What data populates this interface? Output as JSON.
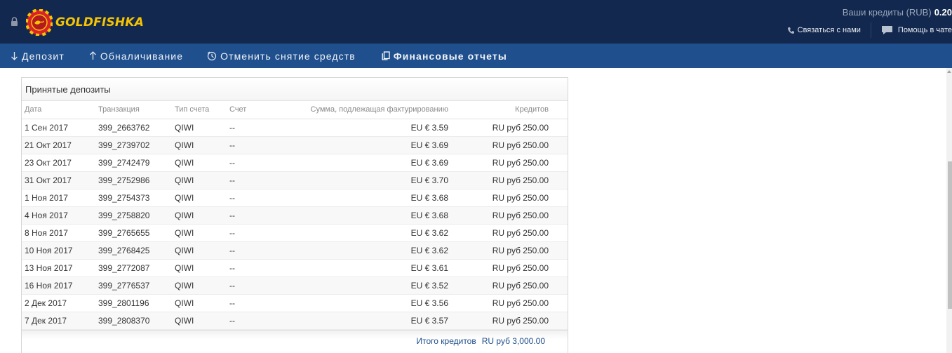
{
  "header": {
    "brand": "GOLDFISHKA",
    "credits_label": "Ваши кредиты (RUB)",
    "credits_value": "0.20",
    "contact_label": "Связаться с нами",
    "chat_label": "Помощь в чате"
  },
  "nav": {
    "deposit": "Депозит",
    "cashout": "Обналичивание",
    "cancel": "Отменить снятие средств",
    "reports": "Финансовые отчеты"
  },
  "panel": {
    "title": "Принятые депозиты",
    "columns": [
      "Дата",
      "Транзакция",
      "Тип счета",
      "Счет",
      "Сумма, подлежащая фактурированию",
      "Кредитов"
    ],
    "rows": [
      [
        "1 Сен 2017",
        "399_2663762",
        "QIWI",
        "--",
        "EU € 3.59",
        "RU руб 250.00"
      ],
      [
        "21 Окт 2017",
        "399_2739702",
        "QIWI",
        "--",
        "EU € 3.69",
        "RU руб 250.00"
      ],
      [
        "23 Окт 2017",
        "399_2742479",
        "QIWI",
        "--",
        "EU € 3.69",
        "RU руб 250.00"
      ],
      [
        "31 Окт 2017",
        "399_2752986",
        "QIWI",
        "--",
        "EU € 3.70",
        "RU руб 250.00"
      ],
      [
        "1 Ноя 2017",
        "399_2754373",
        "QIWI",
        "--",
        "EU € 3.68",
        "RU руб 250.00"
      ],
      [
        "4 Ноя 2017",
        "399_2758820",
        "QIWI",
        "--",
        "EU € 3.68",
        "RU руб 250.00"
      ],
      [
        "8 Ноя 2017",
        "399_2765655",
        "QIWI",
        "--",
        "EU € 3.62",
        "RU руб 250.00"
      ],
      [
        "10 Ноя 2017",
        "399_2768425",
        "QIWI",
        "--",
        "EU € 3.62",
        "RU руб 250.00"
      ],
      [
        "13 Ноя 2017",
        "399_2772087",
        "QIWI",
        "--",
        "EU € 3.61",
        "RU руб 250.00"
      ],
      [
        "16 Ноя 2017",
        "399_2776537",
        "QIWI",
        "--",
        "EU € 3.52",
        "RU руб 250.00"
      ],
      [
        "2 Дек 2017",
        "399_2801196",
        "QIWI",
        "--",
        "EU € 3.56",
        "RU руб 250.00"
      ],
      [
        "7 Дек 2017",
        "399_2808370",
        "QIWI",
        "--",
        "EU € 3.57",
        "RU руб 250.00"
      ]
    ],
    "total_label": "Итого кредитов",
    "total_value": "RU руб 3,000.00"
  },
  "colors": {
    "topbar": "#12284e",
    "navbar": "#1f4f8c",
    "brand": "#f5c400",
    "logo_chip": "#d8232a"
  },
  "icons": {
    "lock": "lock-icon",
    "logo": "casino-chip-icon",
    "phone": "phone-icon",
    "chat": "chat-bubble-icon",
    "deposit": "arrow-down-icon",
    "cashout": "arrow-up-icon",
    "cancel": "clock-cancel-icon",
    "reports": "document-copy-icon"
  }
}
